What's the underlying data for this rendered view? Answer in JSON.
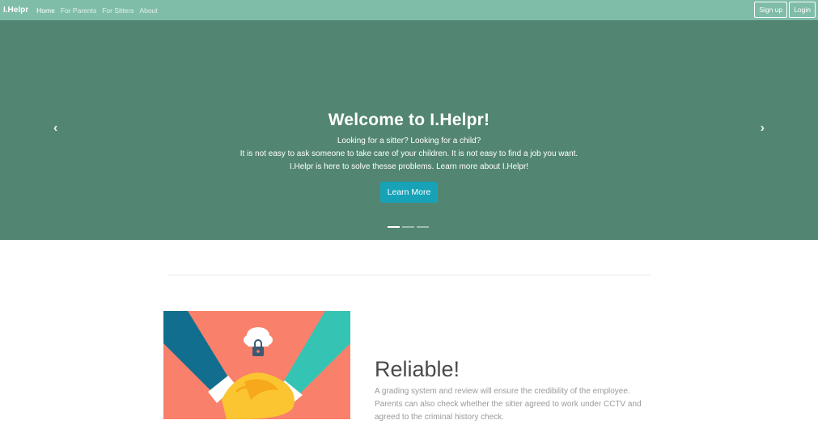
{
  "navbar": {
    "brand": "I.Helpr",
    "links": [
      {
        "label": "Home",
        "active": true
      },
      {
        "label": "For Parents",
        "active": false
      },
      {
        "label": "For Sitters",
        "active": false
      },
      {
        "label": "About",
        "active": false
      }
    ],
    "signup_label": "Sign up",
    "login_label": "Login"
  },
  "carousel": {
    "title": "Welcome to I.Helpr!",
    "lines": [
      "Looking for a sitter? Looking for a child?",
      "It is not easy to ask someone to take care of your children. It is not easy to find a job you want.",
      "I.Helpr is here to solve thesse problems. Learn more about I.Helpr!"
    ],
    "button_label": "Learn More",
    "prev_icon": "‹",
    "next_icon": "›",
    "slide_count": 3,
    "active_slide": 1
  },
  "feature": {
    "heading": "Reliable!",
    "text_lines": [
      "A grading system and review will ensure the credibility of the employee.",
      "Parents can also check whether the sitter agreed to work under CCTV and",
      "agreed to the criminal history check."
    ],
    "image_icon": "handshake-cloud-lock-illustration"
  },
  "colors": {
    "navbar": "#7fbda9",
    "carousel": "#538672",
    "button": "#17a2b8",
    "illustration_bg": "#f9806a",
    "sleeve_left": "#126e8e",
    "sleeve_right": "#35c4b4",
    "hands": "#fbc531"
  }
}
